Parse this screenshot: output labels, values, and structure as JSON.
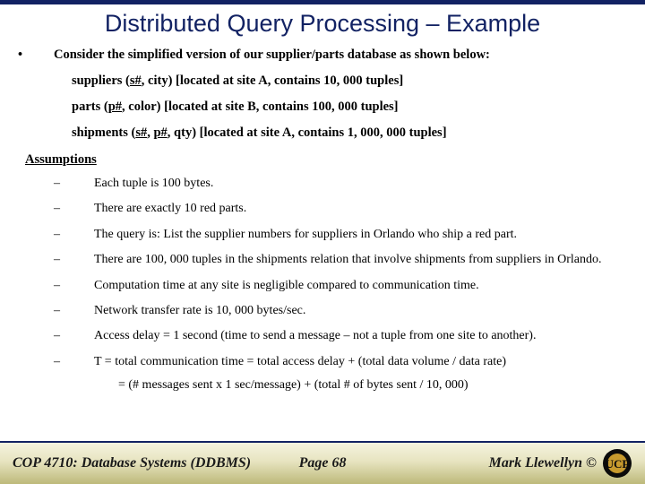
{
  "title": "Distributed Query Processing – Example",
  "intro": "Consider the simplified version of our supplier/parts database as shown below:",
  "schema": {
    "suppliers": {
      "prefix": "suppliers (",
      "key": "s#",
      "rest": ", city)  [located at site A, contains 10, 000 tuples]"
    },
    "parts": {
      "prefix": "parts (",
      "key": "p#",
      "rest": ", color)  [located at site B, contains 100, 000 tuples]"
    },
    "shipments": {
      "prefix": "shipments (",
      "key1": "s#",
      "mid": ", ",
      "key2": "p#",
      "rest": ", qty)  [located at site A, contains 1, 000, 000 tuples]"
    }
  },
  "assumptions_header": "Assumptions",
  "assumptions": [
    "Each tuple is 100 bytes.",
    "There are exactly 10 red parts.",
    "The query is:  List the supplier numbers for suppliers in Orlando who ship a red part.",
    "There are 100, 000 tuples in the shipments relation that involve shipments from suppliers in Orlando.",
    "Computation time at any site is negligible compared to communication time.",
    "Network transfer rate is 10, 000 bytes/sec.",
    "Access delay = 1 second (time to send a message – not a tuple from one site to another).",
    "T = total communication time = total access delay + (total data volume / data rate)"
  ],
  "formula": "= (# messages sent  x  1 sec/message) + (total # of bytes sent / 10, 000)",
  "footer": {
    "course": "COP 4710: Database Systems  (DDBMS)",
    "page": "Page 68",
    "author": "Mark Llewellyn ©"
  }
}
